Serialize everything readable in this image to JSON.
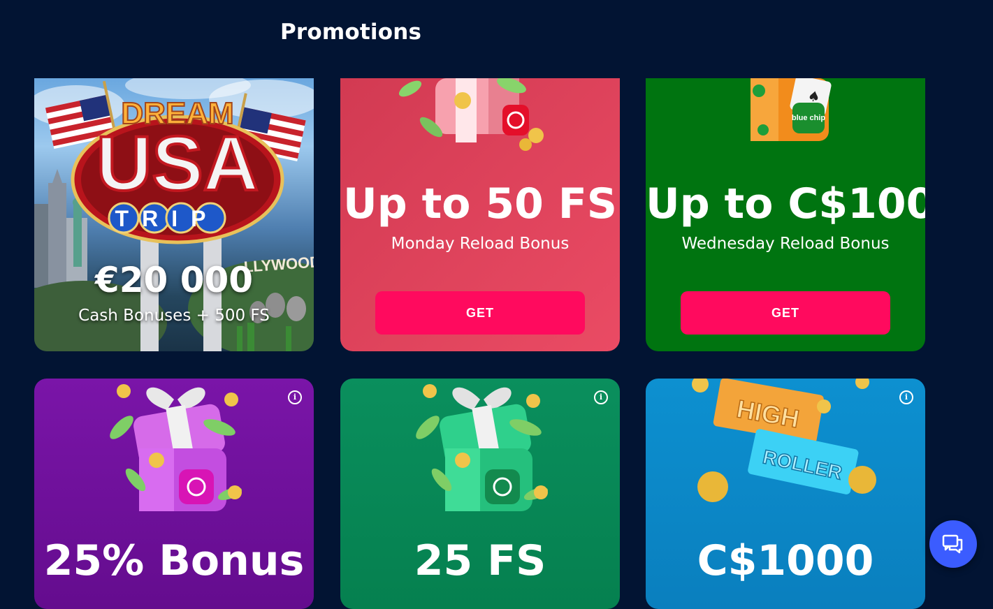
{
  "page": {
    "title": "Promotions"
  },
  "cards": [
    {
      "headline": "€20 000",
      "sub": "Cash Bonuses + 500 FS",
      "art_text": [
        "DREAM",
        "USA",
        "TRIP",
        "LLYWOOD"
      ]
    },
    {
      "headline": "Up to 50 FS",
      "sub": "Monday Reload Bonus",
      "button": "GET",
      "color": "#e2445a"
    },
    {
      "headline": "Up to C$100",
      "sub": "Wednesday Reload Bonus",
      "button": "GET",
      "color": "#007410",
      "art_text": [
        "blue chip"
      ]
    },
    {
      "headline": "25% Bonus",
      "color": "#6f0f9a",
      "info": "i"
    },
    {
      "headline": "25 FS",
      "color": "#058a57",
      "info": "i"
    },
    {
      "headline": "C$1000",
      "color": "#0a87c8",
      "info": "i",
      "art_text": [
        "HIGH",
        "ROLLER"
      ]
    }
  ],
  "chat": {
    "icon": "chat-bubbles-icon"
  }
}
